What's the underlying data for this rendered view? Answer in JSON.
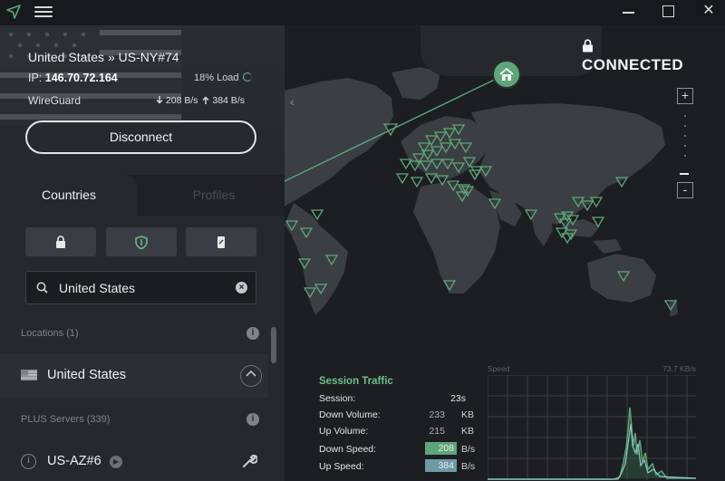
{
  "window": {
    "controls": {
      "minimize": "minimize",
      "maximize": "maximize",
      "close": "✕"
    }
  },
  "connection": {
    "server_title": "United States » US-NY#74",
    "ip_label": "IP:",
    "ip_value": "146.70.72.164",
    "load": "18% Load",
    "load_fraction": 0.18,
    "protocol": "WireGuard",
    "down_speed": "208 B/s",
    "up_speed": "384 B/s",
    "disconnect_label": "Disconnect"
  },
  "tabs": {
    "countries": "Countries",
    "profiles": "Profiles"
  },
  "filters": [
    "secure-core",
    "netshield",
    "streaming"
  ],
  "search": {
    "value": "United States"
  },
  "list": {
    "locations_label": "Locations (1)",
    "country": "United States",
    "plus_label": "PLUS Servers (339)",
    "server": "US-AZ#6"
  },
  "map": {
    "status": "CONNECTED",
    "zoom_in": "+",
    "zoom_out": "-",
    "left_arrow": "‹"
  },
  "traffic": {
    "title": "Session Traffic",
    "rows": [
      {
        "label": "Session:",
        "value": "23s",
        "unit": ""
      },
      {
        "label": "Down Volume:",
        "value": "233",
        "unit": "KB"
      },
      {
        "label": "Up Volume:",
        "value": "215",
        "unit": "KB"
      },
      {
        "label": "Down Speed:",
        "value": "208",
        "unit": "B/s"
      },
      {
        "label": "Up Speed:",
        "value": "384",
        "unit": "B/s"
      }
    ]
  },
  "speed_graph": {
    "label": "Speed",
    "max_label": "73.7 KB/s"
  },
  "colors": {
    "accent": "#5ea67a",
    "up_accent": "#6f9aa3",
    "background": "#1c1e21",
    "panel": "#25282c"
  }
}
